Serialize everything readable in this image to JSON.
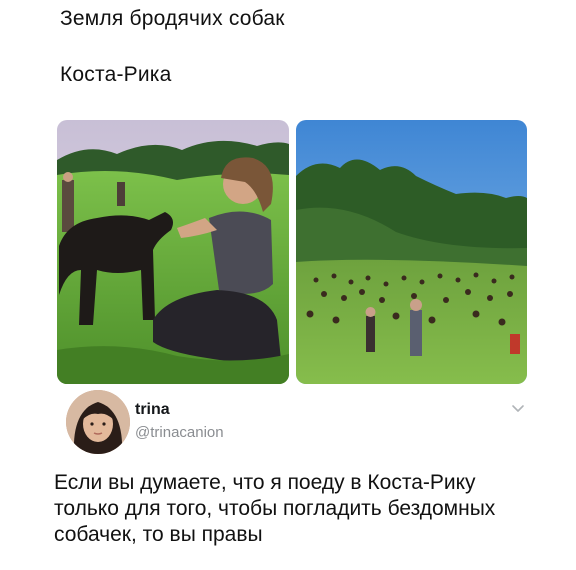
{
  "meme": {
    "caption_line1": "Земля бродячих собак",
    "caption_line2": "Коста-Рика"
  },
  "tweet": {
    "user_name": "trina",
    "user_handle": "@trinacanion",
    "text": "Если вы думаете, что я поеду в Коста-Рику только для того, чтобы погладить бездомных собачек, то вы правы",
    "menu_icon": "chevron-down-icon"
  },
  "colors": {
    "grass": "#6fae3a",
    "sky": "#4b8fd6",
    "handle_gray": "#8a8d91",
    "text": "#111111"
  }
}
